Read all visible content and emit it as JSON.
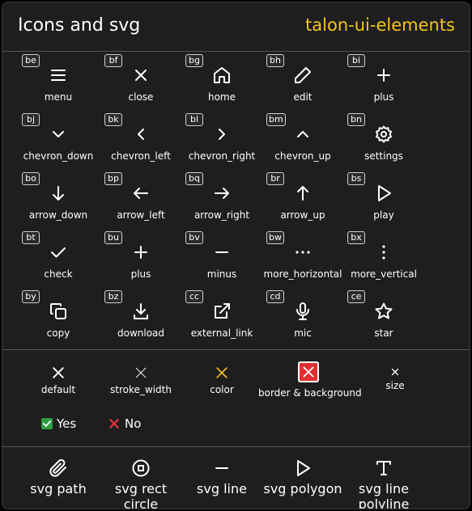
{
  "header": {
    "title": "Icons and svg",
    "brand": "talon-ui-elements"
  },
  "colors": {
    "brand": "#f5c518",
    "yellow": "#f5c518",
    "danger": "#e03030",
    "success": "#2e9e44",
    "no": "#e0303e"
  },
  "icons": [
    {
      "badge": "be",
      "label": "menu",
      "icon": "menu-icon"
    },
    {
      "badge": "bf",
      "label": "close",
      "icon": "close-icon"
    },
    {
      "badge": "bg",
      "label": "home",
      "icon": "home-icon"
    },
    {
      "badge": "bh",
      "label": "edit",
      "icon": "edit-icon"
    },
    {
      "badge": "bi",
      "label": "plus",
      "icon": "plus-icon"
    },
    {
      "badge": "bj",
      "label": "chevron_down",
      "icon": "chevron-down-icon"
    },
    {
      "badge": "bk",
      "label": "chevron_left",
      "icon": "chevron-left-icon"
    },
    {
      "badge": "bl",
      "label": "chevron_right",
      "icon": "chevron-right-icon"
    },
    {
      "badge": "bm",
      "label": "chevron_up",
      "icon": "chevron-up-icon"
    },
    {
      "badge": "bn",
      "label": "settings",
      "icon": "settings-icon"
    },
    {
      "badge": "bo",
      "label": "arrow_down",
      "icon": "arrow-down-icon"
    },
    {
      "badge": "bp",
      "label": "arrow_left",
      "icon": "arrow-left-icon"
    },
    {
      "badge": "bq",
      "label": "arrow_right",
      "icon": "arrow-right-icon"
    },
    {
      "badge": "br",
      "label": "arrow_up",
      "icon": "arrow-up-icon"
    },
    {
      "badge": "bs",
      "label": "play",
      "icon": "play-icon"
    },
    {
      "badge": "bt",
      "label": "check",
      "icon": "check-icon"
    },
    {
      "badge": "bu",
      "label": "plus",
      "icon": "plus-icon"
    },
    {
      "badge": "bv",
      "label": "minus",
      "icon": "minus-icon"
    },
    {
      "badge": "bw",
      "label": "more_horizontal",
      "icon": "more-horizontal-icon"
    },
    {
      "badge": "bx",
      "label": "more_vertical",
      "icon": "more-vertical-icon"
    },
    {
      "badge": "by",
      "label": "copy",
      "icon": "copy-icon"
    },
    {
      "badge": "bz",
      "label": "download",
      "icon": "download-icon"
    },
    {
      "badge": "cc",
      "label": "external_link",
      "icon": "external-link-icon"
    },
    {
      "badge": "cd",
      "label": "mic",
      "icon": "mic-icon"
    },
    {
      "badge": "ce",
      "label": "star",
      "icon": "star-icon"
    }
  ],
  "variants": {
    "default": "default",
    "stroke_width": "stroke_width",
    "color": "color",
    "border_background": "border & background",
    "size": "size"
  },
  "yes_no": {
    "yes": "Yes",
    "no": "No"
  },
  "svg_examples": {
    "path": "svg path",
    "rect_circle": "svg rect circle",
    "line": "svg line",
    "polygon": "svg polygon",
    "polyline": "svg line polyline"
  }
}
